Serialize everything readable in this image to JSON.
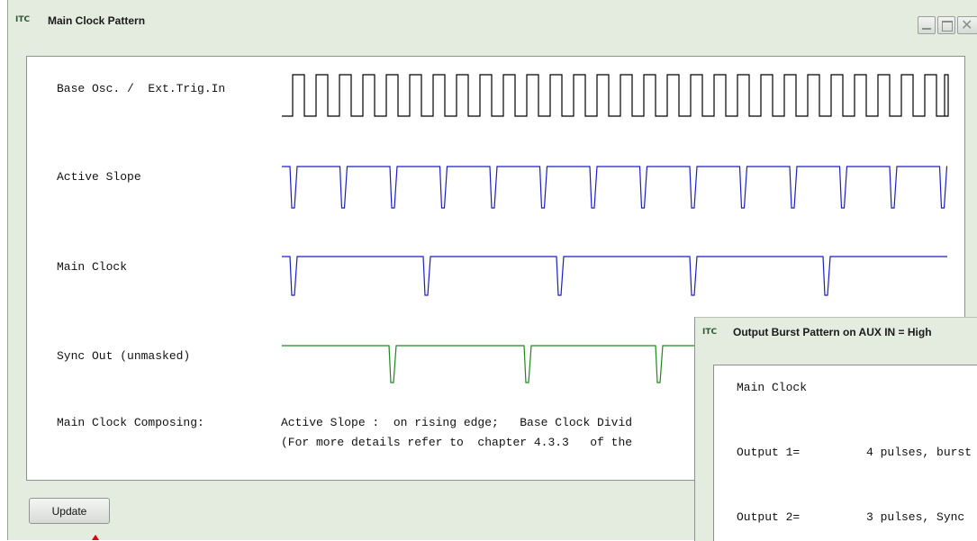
{
  "main_window": {
    "title": "Main Clock Pattern",
    "icon": "app-logo-icon",
    "controls": {
      "minimize": "minimize-icon",
      "maximize": "maximize-icon",
      "close": "close-icon",
      "close_glyph": "✕"
    }
  },
  "signals": [
    {
      "label": "Base Osc. /  Ext.Trig.In",
      "color": "#000000",
      "waveform": "square clock"
    },
    {
      "label": "Active Slope",
      "color": "#1c1cc8",
      "waveform": "falling-edge pulse train"
    },
    {
      "label": "Main Clock",
      "color": "#1c1cc8",
      "waveform": "pulse every fifth slope"
    },
    {
      "label": "Sync Out (unmasked)",
      "color": "#1a8a1a",
      "waveform": "sync pulses"
    }
  ],
  "composing": {
    "label": "Main Clock Composing:",
    "line1": "Active Slope :  on rising edge;   Base Clock Divid",
    "line2": "(For more details refer to  chapter 4.3.3   of the"
  },
  "buttons": {
    "update": "Update"
  },
  "burst_window": {
    "title": "Output Burst Pattern  on  AUX IN = High",
    "icon": "app-logo-icon",
    "rows": [
      {
        "label": "Main Clock",
        "value": ""
      },
      {
        "label": "Output 1=",
        "value": "4 pulses, burst"
      },
      {
        "label": "Output 2=",
        "value": "3 pulses, Sync"
      }
    ]
  }
}
